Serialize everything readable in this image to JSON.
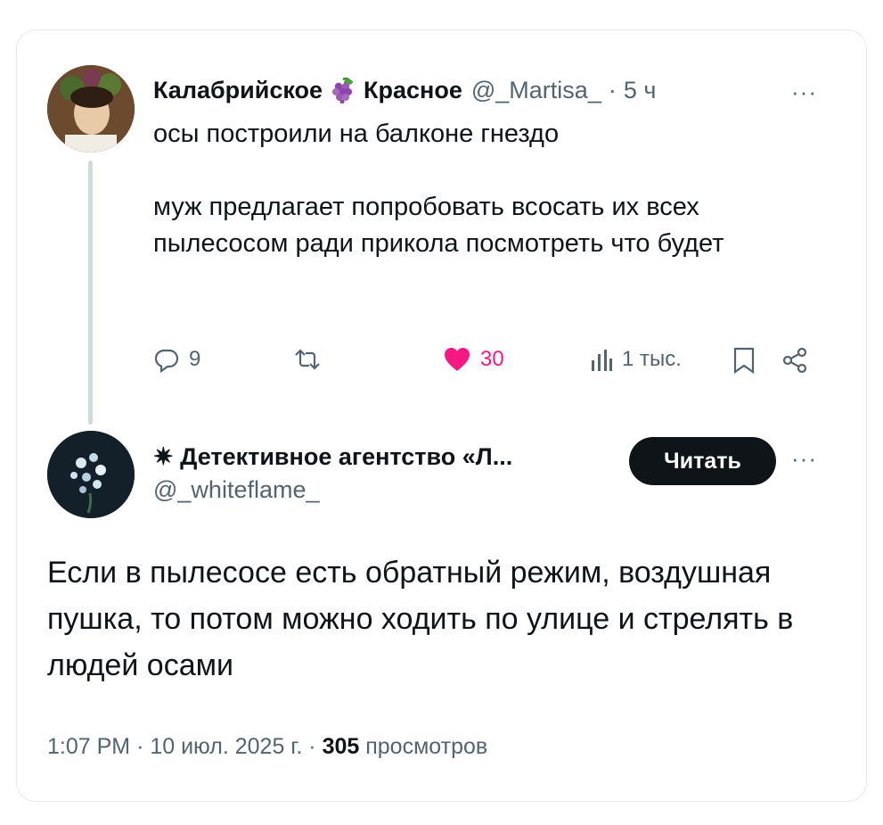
{
  "post": {
    "author_name_part1": "Калабрийское",
    "author_name_part2": "Красное",
    "handle": "@_Martisa_",
    "separator": "·",
    "time": "5 ч",
    "text": "осы построили на балконе гнездо\n\nмуж предлагает попробовать всосать их всех пылесосом ради прикола посмотреть что будет",
    "more": "···",
    "actions": {
      "replies": "9",
      "retweets": "",
      "likes": "30",
      "views": "1 тыс."
    },
    "like_color": "#f91880"
  },
  "reply": {
    "author_name": "✷ Детективное агентство «Л...",
    "handle": "@_whiteflame_",
    "follow_label": "Читать",
    "more": "···",
    "text": "Если в пылесосе есть обратный режим, воздушная пушка, то потом можно ходить по улице и стрелять в людей осами",
    "meta": {
      "time": "1:07 PM",
      "sep1": "·",
      "date": "10 июл. 2025 г.",
      "sep2": "·",
      "views_count": "305",
      "views_label": "просмотров"
    }
  }
}
